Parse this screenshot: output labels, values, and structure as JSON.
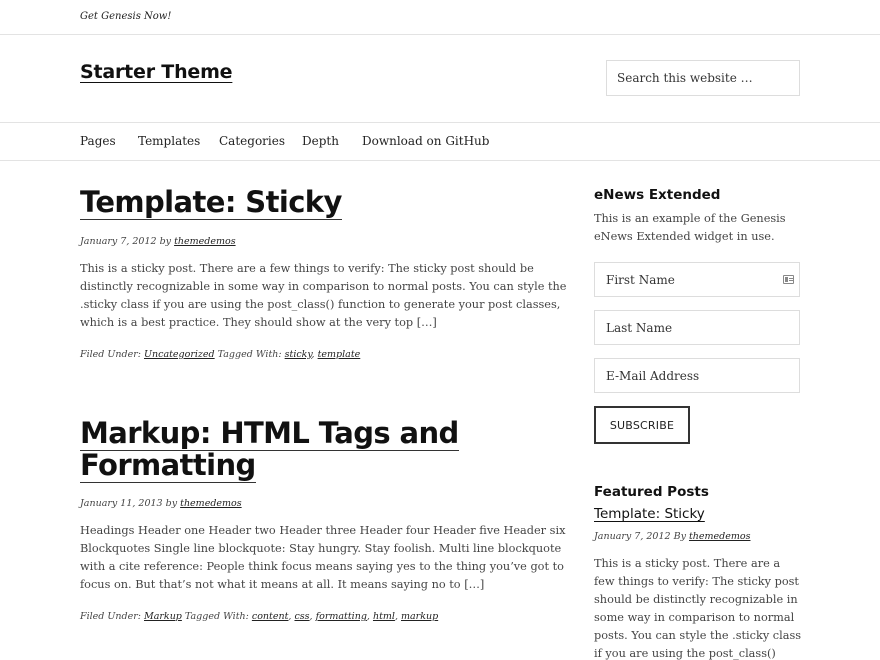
{
  "topbar": {
    "tagline": "Get Genesis Now!"
  },
  "header": {
    "site_title": "Starter Theme",
    "search_placeholder": "Search this website …"
  },
  "nav": {
    "items": [
      "Pages",
      "Templates",
      "Categories",
      "Depth",
      "Download on GitHub"
    ]
  },
  "posts": [
    {
      "title": "Template: Sticky",
      "date": "January 7, 2012",
      "by": "by",
      "author": "themedemos",
      "excerpt": "This is a sticky post. There are a few things to verify: The sticky post should be distinctly recognizable in some way in comparison to normal posts. You can style the .sticky class if you are using the post_class() function to generate your post classes, which is a best practice. They should show at the very top […]",
      "filed_label": "Filed Under:",
      "category": "Uncategorized",
      "tagged_label": "Tagged With:",
      "tags": [
        "sticky",
        "template"
      ]
    },
    {
      "title_line1": "Markup: HTML Tags and",
      "title_line2": "Formatting",
      "date": "January 11, 2013",
      "by": "by",
      "author": "themedemos",
      "excerpt": "Headings Header one Header two Header three Header four Header five Header six Blockquotes Single line blockquote: Stay hungry. Stay foolish. Multi line blockquote with a cite reference: People think focus means saying yes to the thing you’ve got to focus on. But that’s not what it means at all. It means saying no to […]",
      "filed_label": "Filed Under:",
      "category": "Markup",
      "tagged_label": "Tagged With:",
      "tags": [
        "content",
        "css",
        "formatting",
        "html",
        "markup"
      ]
    }
  ],
  "sidebar": {
    "enews": {
      "title": "eNews Extended",
      "text": "This is an example of the Genesis eNews Extended widget in use.",
      "first_name": "First Name",
      "last_name": "Last Name",
      "email": "E-Mail Address",
      "subscribe": "SUBSCRIBE"
    },
    "featured": {
      "title": "Featured Posts",
      "post_title": "Template: Sticky",
      "date": "January 7, 2012",
      "by": "By",
      "author": "themedemos",
      "excerpt": "This is a sticky post. There are a few things to verify: The sticky post should be distinctly recognizable in some way in comparison to normal posts. You can style the .sticky class if you are using the post_class() function to generate your"
    }
  }
}
